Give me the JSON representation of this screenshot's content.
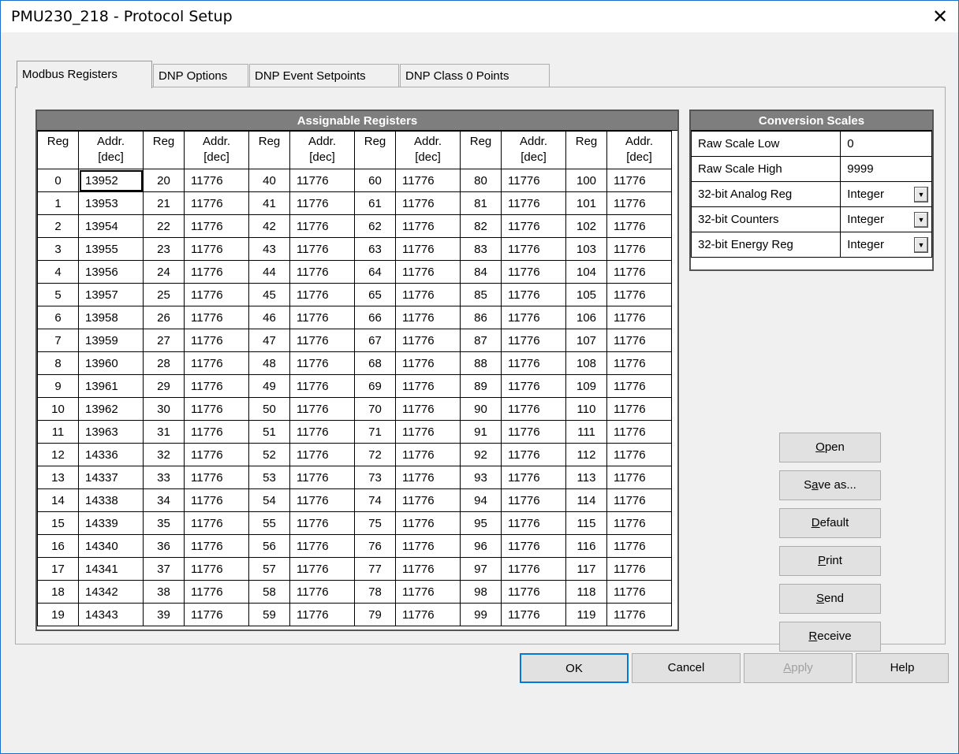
{
  "window": {
    "title": "PMU230_218 - Protocol Setup",
    "close_glyph": "✕"
  },
  "tabs": [
    {
      "label": "Modbus Registers",
      "active": true
    },
    {
      "label": "DNP Options"
    },
    {
      "label": "DNP Event Setpoints"
    },
    {
      "label": "DNP Class 0 Points"
    }
  ],
  "registers": {
    "title": "Assignable Registers",
    "col_reg": "Reg",
    "col_addr_line1": "Addr.",
    "col_addr_line2": "[dec]",
    "rows": [
      [
        [
          "0",
          "13952"
        ],
        [
          "20",
          "11776"
        ],
        [
          "40",
          "11776"
        ],
        [
          "60",
          "11776"
        ],
        [
          "80",
          "11776"
        ],
        [
          "100",
          "11776"
        ]
      ],
      [
        [
          "1",
          "13953"
        ],
        [
          "21",
          "11776"
        ],
        [
          "41",
          "11776"
        ],
        [
          "61",
          "11776"
        ],
        [
          "81",
          "11776"
        ],
        [
          "101",
          "11776"
        ]
      ],
      [
        [
          "2",
          "13954"
        ],
        [
          "22",
          "11776"
        ],
        [
          "42",
          "11776"
        ],
        [
          "62",
          "11776"
        ],
        [
          "82",
          "11776"
        ],
        [
          "102",
          "11776"
        ]
      ],
      [
        [
          "3",
          "13955"
        ],
        [
          "23",
          "11776"
        ],
        [
          "43",
          "11776"
        ],
        [
          "63",
          "11776"
        ],
        [
          "83",
          "11776"
        ],
        [
          "103",
          "11776"
        ]
      ],
      [
        [
          "4",
          "13956"
        ],
        [
          "24",
          "11776"
        ],
        [
          "44",
          "11776"
        ],
        [
          "64",
          "11776"
        ],
        [
          "84",
          "11776"
        ],
        [
          "104",
          "11776"
        ]
      ],
      [
        [
          "5",
          "13957"
        ],
        [
          "25",
          "11776"
        ],
        [
          "45",
          "11776"
        ],
        [
          "65",
          "11776"
        ],
        [
          "85",
          "11776"
        ],
        [
          "105",
          "11776"
        ]
      ],
      [
        [
          "6",
          "13958"
        ],
        [
          "26",
          "11776"
        ],
        [
          "46",
          "11776"
        ],
        [
          "66",
          "11776"
        ],
        [
          "86",
          "11776"
        ],
        [
          "106",
          "11776"
        ]
      ],
      [
        [
          "7",
          "13959"
        ],
        [
          "27",
          "11776"
        ],
        [
          "47",
          "11776"
        ],
        [
          "67",
          "11776"
        ],
        [
          "87",
          "11776"
        ],
        [
          "107",
          "11776"
        ]
      ],
      [
        [
          "8",
          "13960"
        ],
        [
          "28",
          "11776"
        ],
        [
          "48",
          "11776"
        ],
        [
          "68",
          "11776"
        ],
        [
          "88",
          "11776"
        ],
        [
          "108",
          "11776"
        ]
      ],
      [
        [
          "9",
          "13961"
        ],
        [
          "29",
          "11776"
        ],
        [
          "49",
          "11776"
        ],
        [
          "69",
          "11776"
        ],
        [
          "89",
          "11776"
        ],
        [
          "109",
          "11776"
        ]
      ],
      [
        [
          "10",
          "13962"
        ],
        [
          "30",
          "11776"
        ],
        [
          "50",
          "11776"
        ],
        [
          "70",
          "11776"
        ],
        [
          "90",
          "11776"
        ],
        [
          "110",
          "11776"
        ]
      ],
      [
        [
          "11",
          "13963"
        ],
        [
          "31",
          "11776"
        ],
        [
          "51",
          "11776"
        ],
        [
          "71",
          "11776"
        ],
        [
          "91",
          "11776"
        ],
        [
          "111",
          "11776"
        ]
      ],
      [
        [
          "12",
          "14336"
        ],
        [
          "32",
          "11776"
        ],
        [
          "52",
          "11776"
        ],
        [
          "72",
          "11776"
        ],
        [
          "92",
          "11776"
        ],
        [
          "112",
          "11776"
        ]
      ],
      [
        [
          "13",
          "14337"
        ],
        [
          "33",
          "11776"
        ],
        [
          "53",
          "11776"
        ],
        [
          "73",
          "11776"
        ],
        [
          "93",
          "11776"
        ],
        [
          "113",
          "11776"
        ]
      ],
      [
        [
          "14",
          "14338"
        ],
        [
          "34",
          "11776"
        ],
        [
          "54",
          "11776"
        ],
        [
          "74",
          "11776"
        ],
        [
          "94",
          "11776"
        ],
        [
          "114",
          "11776"
        ]
      ],
      [
        [
          "15",
          "14339"
        ],
        [
          "35",
          "11776"
        ],
        [
          "55",
          "11776"
        ],
        [
          "75",
          "11776"
        ],
        [
          "95",
          "11776"
        ],
        [
          "115",
          "11776"
        ]
      ],
      [
        [
          "16",
          "14340"
        ],
        [
          "36",
          "11776"
        ],
        [
          "56",
          "11776"
        ],
        [
          "76",
          "11776"
        ],
        [
          "96",
          "11776"
        ],
        [
          "116",
          "11776"
        ]
      ],
      [
        [
          "17",
          "14341"
        ],
        [
          "37",
          "11776"
        ],
        [
          "57",
          "11776"
        ],
        [
          "77",
          "11776"
        ],
        [
          "97",
          "11776"
        ],
        [
          "117",
          "11776"
        ]
      ],
      [
        [
          "18",
          "14342"
        ],
        [
          "38",
          "11776"
        ],
        [
          "58",
          "11776"
        ],
        [
          "78",
          "11776"
        ],
        [
          "98",
          "11776"
        ],
        [
          "118",
          "11776"
        ]
      ],
      [
        [
          "19",
          "14343"
        ],
        [
          "39",
          "11776"
        ],
        [
          "59",
          "11776"
        ],
        [
          "79",
          "11776"
        ],
        [
          "99",
          "11776"
        ],
        [
          "119",
          "11776"
        ]
      ]
    ]
  },
  "conversion": {
    "title": "Conversion Scales",
    "rows": [
      {
        "label": "Raw Scale Low",
        "value": "0",
        "type": "text"
      },
      {
        "label": "Raw Scale High",
        "value": "9999",
        "type": "text"
      },
      {
        "label": "32-bit Analog Reg",
        "value": "Integer",
        "type": "combo"
      },
      {
        "label": "32-bit Counters",
        "value": "Integer",
        "type": "combo"
      },
      {
        "label": "32-bit Energy Reg",
        "value": "Integer",
        "type": "combo"
      }
    ],
    "dropdown_glyph": "▼"
  },
  "side_buttons": [
    {
      "pre": "",
      "acc": "O",
      "post": "pen",
      "name": "open-button"
    },
    {
      "pre": "S",
      "acc": "a",
      "post": "ve as...",
      "name": "save-as-button"
    },
    {
      "pre": "",
      "acc": "D",
      "post": "efault",
      "name": "default-button"
    },
    {
      "pre": "",
      "acc": "P",
      "post": "rint",
      "name": "print-button"
    },
    {
      "pre": "",
      "acc": "S",
      "post": "end",
      "name": "send-button"
    },
    {
      "pre": "",
      "acc": "R",
      "post": "eceive",
      "name": "receive-button"
    }
  ],
  "bottom_buttons": {
    "ok": "OK",
    "cancel": "Cancel",
    "apply_acc": "A",
    "apply_rest": "pply",
    "help": "Help"
  }
}
